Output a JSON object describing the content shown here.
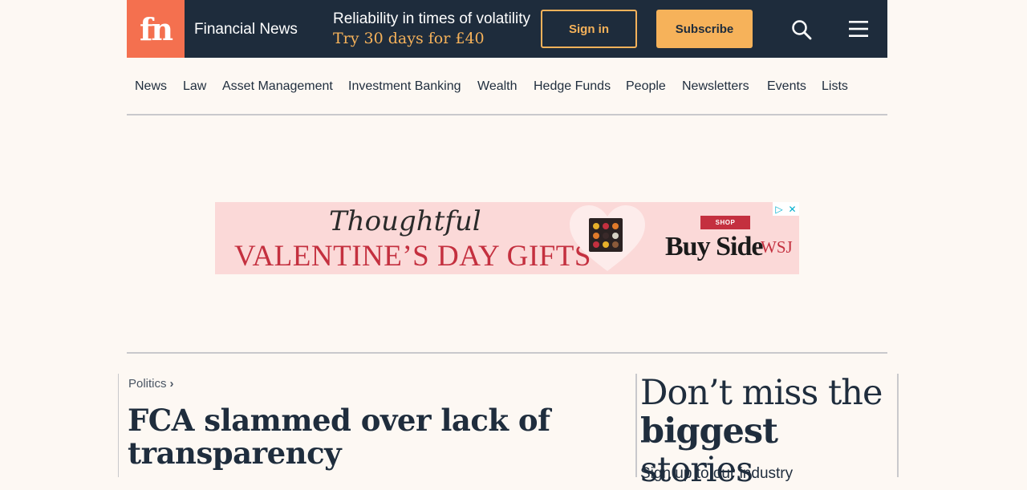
{
  "header": {
    "logo": "fn",
    "brand": "Financial News",
    "promo_line1": "Reliability in times of volatility",
    "promo_line2": "Try 30 days for £40",
    "signin_label": "Sign in",
    "subscribe_label": "Subscribe",
    "icons": [
      "search-icon",
      "menu-icon"
    ],
    "colors": {
      "header_bg": "#1e2c3c",
      "logo_bg": "#f4704f",
      "accent": "#f6b25a"
    }
  },
  "nav": {
    "items": [
      "News",
      "Law",
      "Asset Management",
      "Investment Banking",
      "Wealth",
      "Hedge Funds",
      "People",
      "Newsletters",
      "Events",
      "Lists"
    ]
  },
  "ad": {
    "script_line": "Thoughtful",
    "title": "VALENTINE’S DAY GIFTS",
    "shop_label": "SHOP",
    "brand": "Buy Side",
    "brand_from": "WSJ"
  },
  "article": {
    "section": "Politics",
    "headline": "FCA slammed over lack of transparency"
  },
  "sidebar": {
    "title_part1": "Don’t miss the",
    "title_bold": "biggest",
    "title_part2": "stories",
    "subtitle": "Sign up to our industry"
  }
}
